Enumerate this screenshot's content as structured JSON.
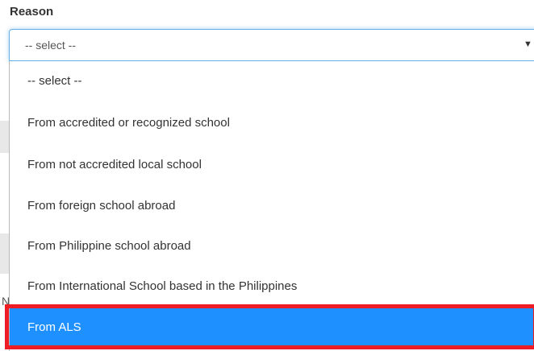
{
  "form": {
    "reason_label": "Reason",
    "reason_select": {
      "selected_value": "-- select --",
      "caret_icon": "caret-down-icon",
      "caret_glyph": "▼"
    }
  },
  "dropdown": {
    "options": [
      {
        "label": "-- select --"
      },
      {
        "label": "From accredited or recognized school"
      },
      {
        "label": "From not accredited local school"
      },
      {
        "label": "From foreign school abroad"
      },
      {
        "label": "From Philippine school abroad"
      },
      {
        "label": "From International School based in the Philippines"
      },
      {
        "label": "From ALS"
      }
    ],
    "highlighted_option": "From ALS"
  },
  "background": {
    "partial_glyph": "N"
  },
  "colors": {
    "focus_border": "#66afe9",
    "highlight_background": "#1e90ff",
    "highlight_text": "#ffffff",
    "annotation_border": "#ee1c25",
    "text": "#333333"
  }
}
